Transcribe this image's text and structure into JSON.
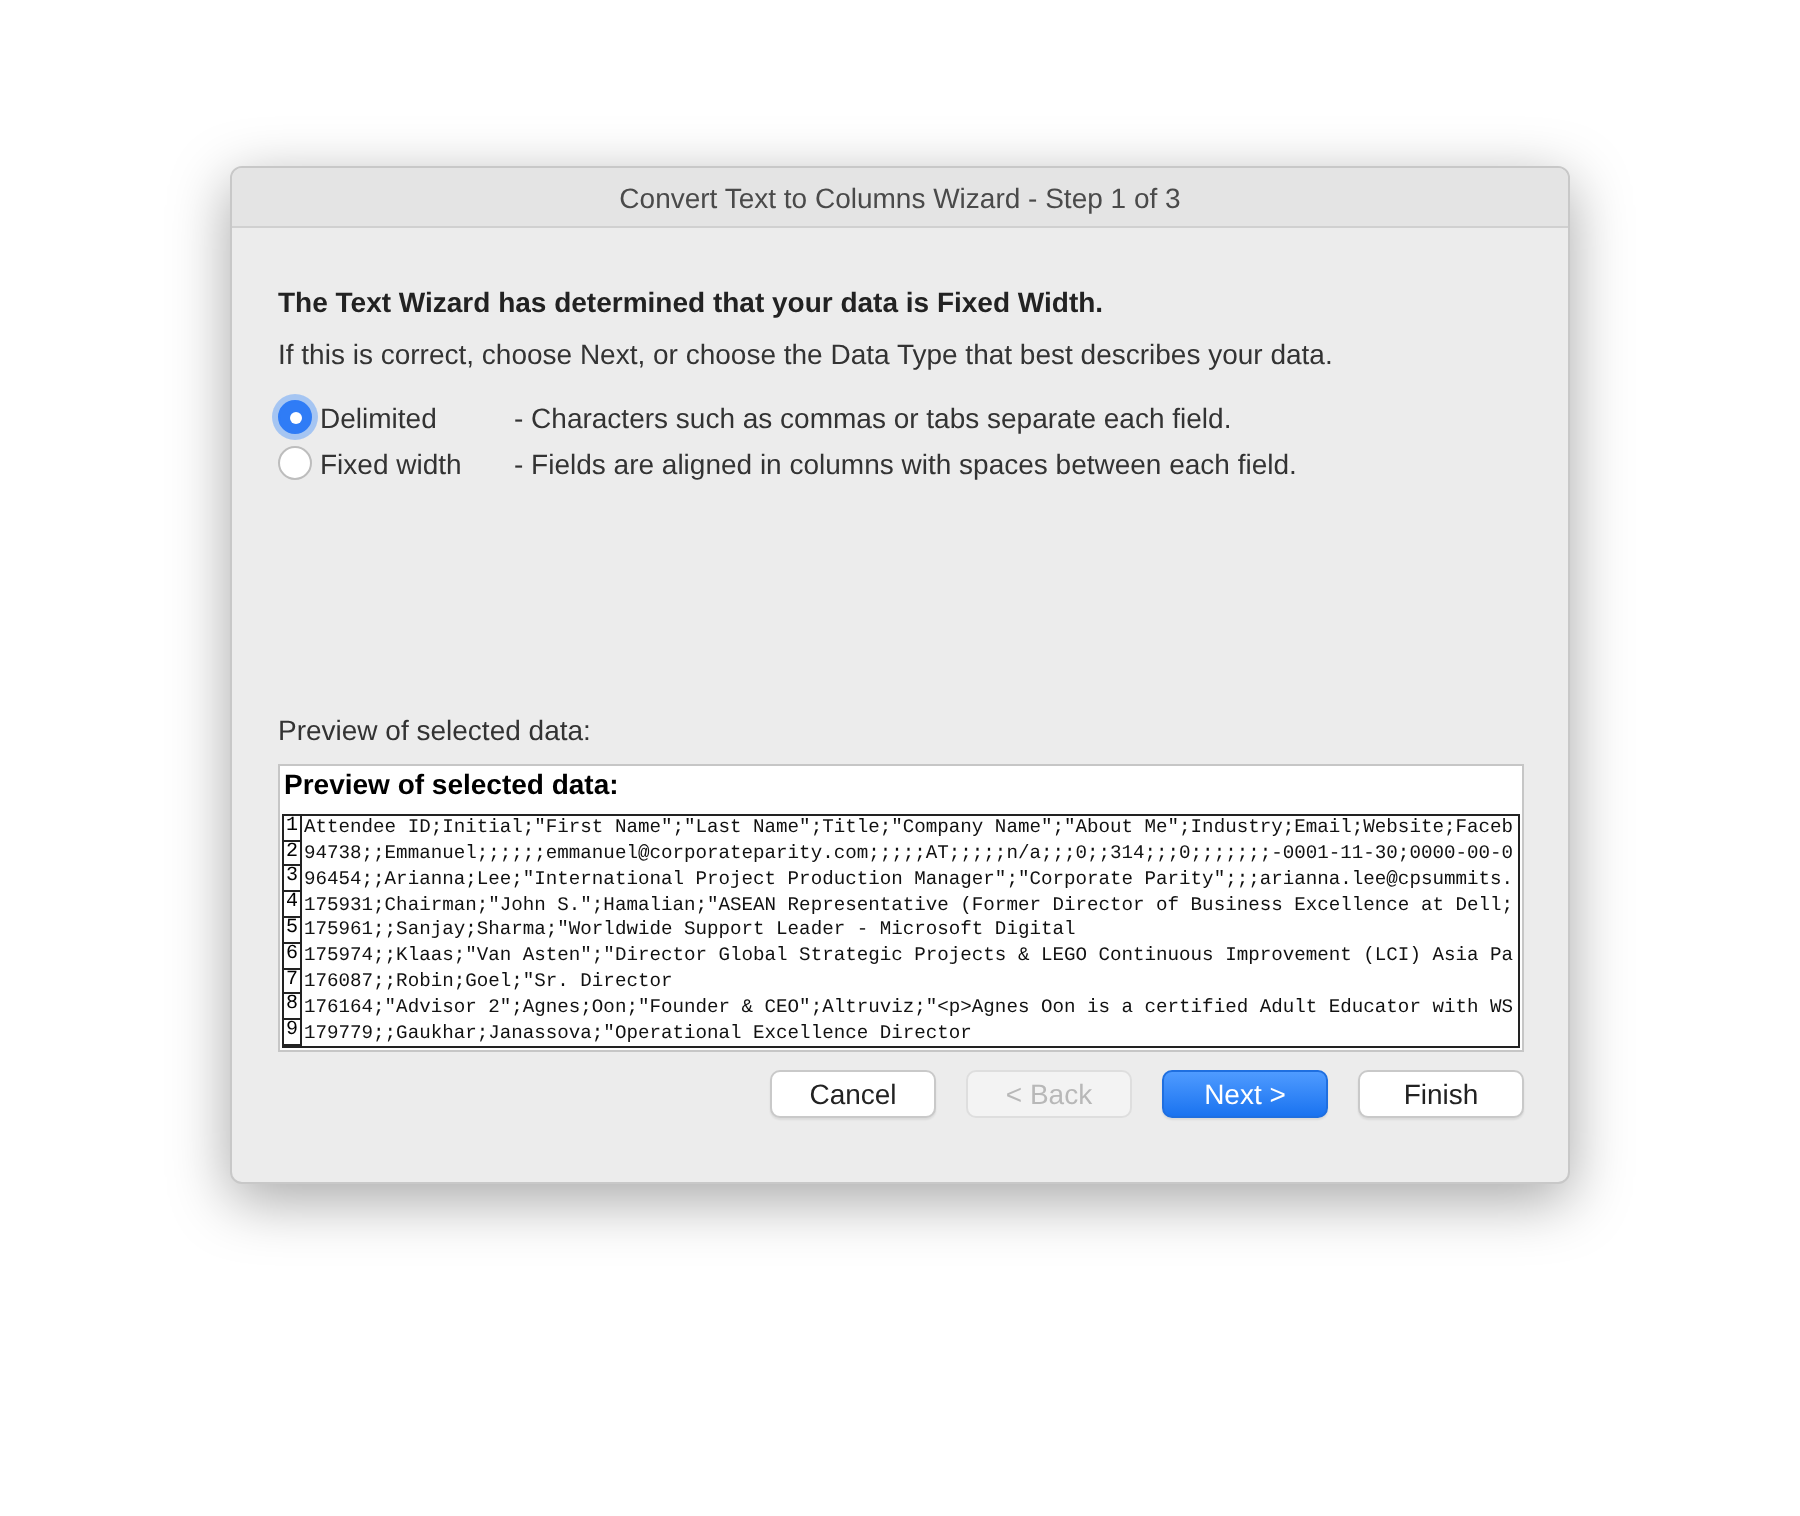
{
  "window": {
    "title": "Convert Text to Columns Wizard - Step 1 of 3"
  },
  "heading": "The Text Wizard has determined that your data is Fixed Width.",
  "instruction": "If this is correct, choose Next, or choose the Data Type that best describes your data.",
  "options": [
    {
      "label": "Delimited",
      "description": "- Characters such as commas or tabs separate each field.",
      "selected": true
    },
    {
      "label": "Fixed width",
      "description": "- Fields are aligned in columns with spaces between each field.",
      "selected": false
    }
  ],
  "preview": {
    "label": "Preview of selected data:",
    "title": "Preview of selected data:",
    "rows": [
      {
        "number": "1",
        "text": "Attendee ID;Initial;\"First Name\";\"Last Name\";Title;\"Company Name\";\"About Me\";Industry;Email;Website;Faceb"
      },
      {
        "number": "2",
        "text": "94738;;Emmanuel;;;;;;emmanuel@corporateparity.com;;;;;AT;;;;;n/a;;;0;;314;;;0;;;;;;;-0001-11-30;0000-00-0"
      },
      {
        "number": "3",
        "text": "96454;;Arianna;Lee;\"International Project Production Manager\";\"Corporate Parity\";;;arianna.lee@cpsummits."
      },
      {
        "number": "4",
        "text": "175931;Chairman;\"John S.\";Hamalian;\"ASEAN Representative (Former Director of Business Excellence at Dell;"
      },
      {
        "number": "5",
        "text": "175961;;Sanjay;Sharma;\"Worldwide Support Leader - Microsoft Digital"
      },
      {
        "number": "6",
        "text": "175974;;Klaas;\"Van Asten\";\"Director Global Strategic Projects & LEGO Continuous Improvement (LCI) Asia Pa"
      },
      {
        "number": "7",
        "text": "176087;;Robin;Goel;\"Sr. Director"
      },
      {
        "number": "8",
        "text": "176164;\"Advisor 2\";Agnes;Oon;\"Founder & CEO\";Altruviz;\"<p>Agnes Oon is a certified Adult Educator with WS"
      },
      {
        "number": "9",
        "text": "179779;;Gaukhar;Janassova;\"Operational Excellence Director"
      }
    ]
  },
  "buttons": [
    {
      "label": "Cancel",
      "kind": "normal",
      "disabled": false
    },
    {
      "label": "< Back",
      "kind": "normal",
      "disabled": true
    },
    {
      "label": "Next >",
      "kind": "default",
      "disabled": false
    },
    {
      "label": "Finish",
      "kind": "normal",
      "disabled": false
    }
  ]
}
